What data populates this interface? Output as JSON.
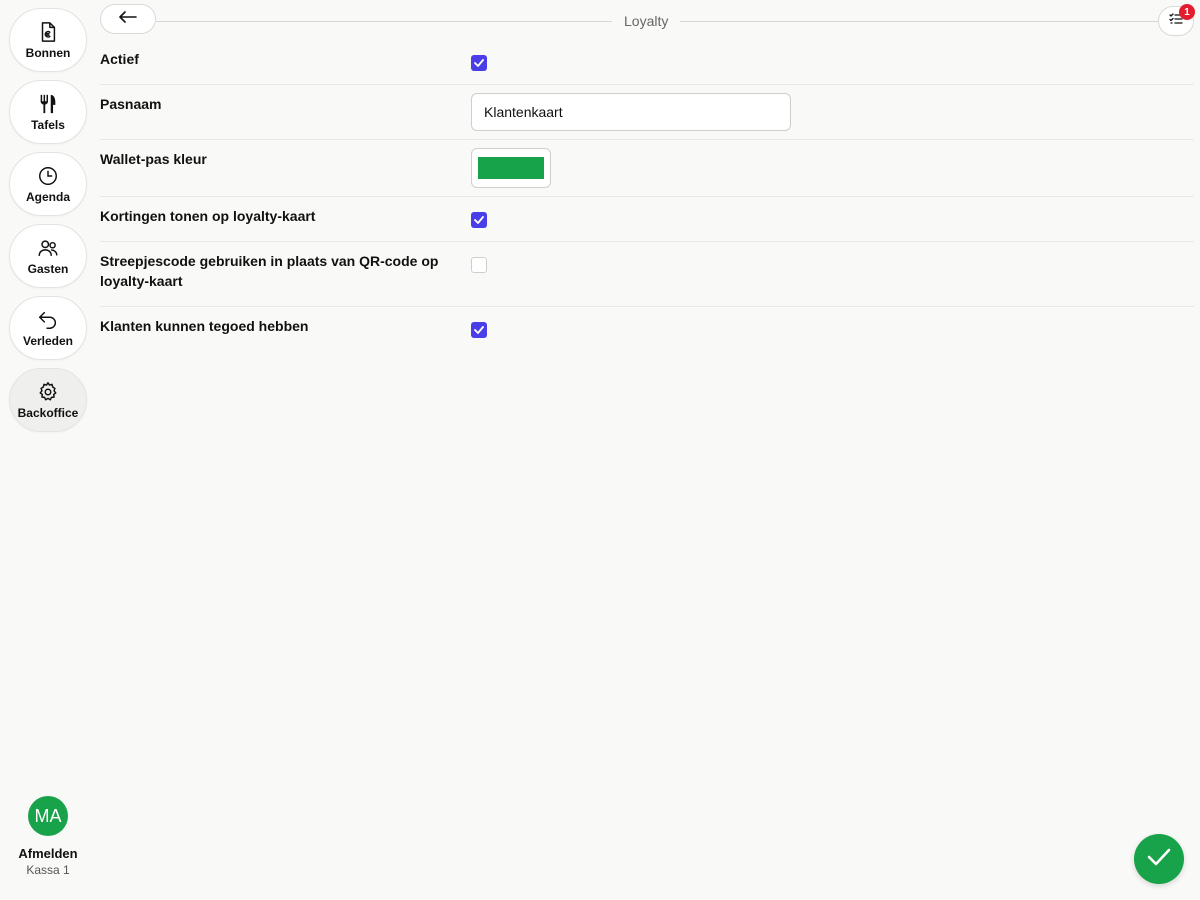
{
  "sidebar": {
    "items": [
      {
        "label": "Bonnen",
        "icon": "receipt-euro-icon"
      },
      {
        "label": "Tafels",
        "icon": "fork-knife-icon"
      },
      {
        "label": "Agenda",
        "icon": "clock-icon"
      },
      {
        "label": "Gasten",
        "icon": "users-icon"
      },
      {
        "label": "Verleden",
        "icon": "undo-arrow-icon"
      },
      {
        "label": "Backoffice",
        "icon": "gear-icon"
      }
    ],
    "active": "Backoffice"
  },
  "user": {
    "initials": "MA",
    "logout_label": "Afmelden",
    "terminal": "Kassa 1"
  },
  "header": {
    "title": "Loyalty",
    "back_icon": "arrow-left-icon",
    "tasks_icon": "checklist-icon",
    "tasks_badge": "1"
  },
  "form": {
    "fields": [
      {
        "label": "Actief",
        "type": "checkbox",
        "checked": true
      },
      {
        "label": "Pasnaam",
        "type": "text",
        "value": "Klantenkaart"
      },
      {
        "label": "Wallet-pas kleur",
        "type": "color",
        "value": "#17a34a"
      },
      {
        "label": "Kortingen tonen op loyalty-kaart",
        "type": "checkbox",
        "checked": true
      },
      {
        "label": "Streepjescode gebruiken in plaats van QR-code op loyalty-kaart",
        "type": "checkbox",
        "checked": false
      },
      {
        "label": "Klanten kunnen tegoed hebben",
        "type": "checkbox",
        "checked": true
      }
    ]
  },
  "colors": {
    "accent": "#4a3ee8",
    "brand_green": "#18a34a",
    "badge_red": "#e11d2e"
  },
  "save_icon": "checkmark-icon"
}
